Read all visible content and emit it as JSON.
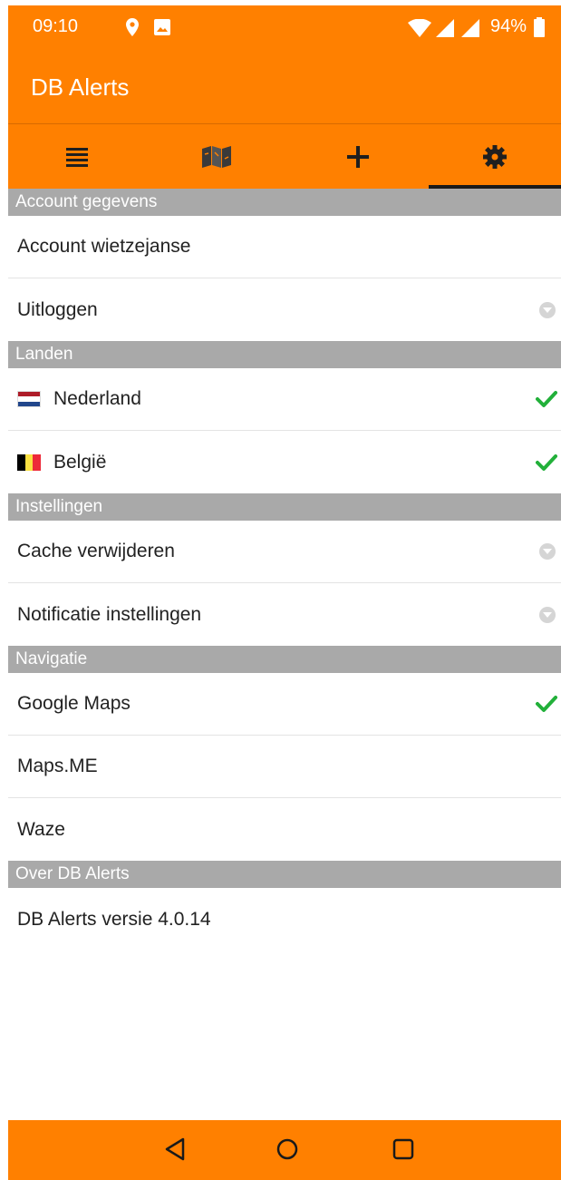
{
  "status_bar": {
    "time": "09:10",
    "battery": "94%",
    "icons": [
      "location-pin-icon",
      "image-icon",
      "wifi-icon",
      "signal-icon",
      "signal-icon",
      "battery-icon"
    ]
  },
  "app": {
    "title": "DB Alerts",
    "accent_color": "#ff8000"
  },
  "tabs": [
    {
      "icon": "list-icon",
      "active": false
    },
    {
      "icon": "map-icon",
      "active": false
    },
    {
      "icon": "plus-icon",
      "active": false
    },
    {
      "icon": "gear-icon",
      "active": true
    }
  ],
  "sections": [
    {
      "header": "Account gegevens",
      "items": [
        {
          "label": "Account wietzejanse",
          "trailing": "none"
        },
        {
          "label": "Uitloggen",
          "trailing": "dropdown"
        }
      ]
    },
    {
      "header": "Landen",
      "items": [
        {
          "label": "Nederland",
          "flag": "flag-netherlands-icon",
          "trailing": "check"
        },
        {
          "label": "België",
          "flag": "flag-belgium-icon",
          "trailing": "check"
        }
      ]
    },
    {
      "header": "Instellingen",
      "items": [
        {
          "label": "Cache verwijderen",
          "trailing": "dropdown"
        },
        {
          "label": "Notificatie instellingen",
          "trailing": "dropdown"
        }
      ]
    },
    {
      "header": "Navigatie",
      "items": [
        {
          "label": "Google Maps",
          "trailing": "check"
        },
        {
          "label": "Maps.ME",
          "trailing": "none"
        },
        {
          "label": "Waze",
          "trailing": "none"
        }
      ]
    },
    {
      "header": "Over DB Alerts",
      "items": [
        {
          "label": "DB Alerts versie 4.0.14",
          "trailing": "none"
        }
      ]
    }
  ],
  "colors": {
    "section_header": "#a9a9a9",
    "check": "#22b03a",
    "divider": "#e3e3e3"
  },
  "nav_bar": [
    "back-icon",
    "home-icon",
    "recents-icon"
  ]
}
